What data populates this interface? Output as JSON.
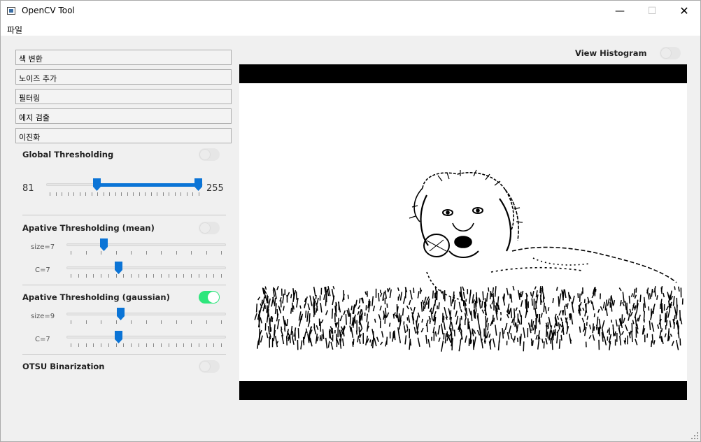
{
  "window": {
    "title": "OpenCV Tool"
  },
  "menu": {
    "file": "파일"
  },
  "sections": {
    "color_convert": "색 변환",
    "add_noise": "노이즈 추가",
    "filtering": "필터링",
    "edge_detect": "에지 검출",
    "binarization": "이진화"
  },
  "global_threshold": {
    "title": "Global Thresholding",
    "enabled": false,
    "low": "81",
    "high": "255",
    "min": 0,
    "max": 255
  },
  "adaptive_mean": {
    "title": "Apative Thresholding (mean)",
    "enabled": false,
    "size_label": "size=7",
    "c_label": "C=7",
    "size_fraction": 0.23,
    "c_fraction": 0.33
  },
  "adaptive_gaussian": {
    "title": "Apative Thresholding (gaussian)",
    "enabled": true,
    "size_label": "size=9",
    "c_label": "C=7",
    "size_fraction": 0.34,
    "c_fraction": 0.33
  },
  "otsu": {
    "title": "OTSU Binarization",
    "enabled": false
  },
  "histogram": {
    "label": "View Histogram",
    "enabled": false
  },
  "image": {
    "description_icon": "binary-dog-image"
  },
  "colors": {
    "accent": "#0b74d6",
    "toggle_on": "#2ee67c"
  }
}
